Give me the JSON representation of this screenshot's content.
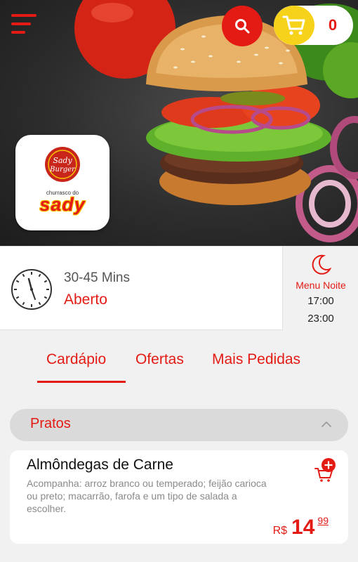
{
  "header": {
    "menu_icon": "hamburger-menu-icon",
    "search_icon": "search-icon",
    "cart_icon": "cart-icon",
    "cart_count": "0"
  },
  "store": {
    "logo_top_text": "Sady Burger",
    "logo_subtitle": "churrasco do",
    "logo_name": "sady"
  },
  "info": {
    "delivery_time": "30-45 Mins",
    "status": "Aberto",
    "menu_title": "Menu Noite",
    "open_time": "17:00",
    "close_time": "23:00"
  },
  "tabs": [
    {
      "label": "Cardápio",
      "active": true
    },
    {
      "label": "Ofertas",
      "active": false
    },
    {
      "label": "Mais Pedidas",
      "active": false
    }
  ],
  "category": {
    "label": "Pratos",
    "expanded": true
  },
  "products": [
    {
      "name": "Almôndegas de Carne",
      "description": "Acompanha: arroz branco ou temperado; feijão carioca ou preto; macarrão, farofa e um tipo de salada a escolher.",
      "currency": "R$",
      "price_int": "14",
      "price_dec": "99"
    }
  ],
  "colors": {
    "accent": "#e31b14",
    "cart_yellow": "#f7d21a",
    "background": "#f1f1f1"
  }
}
